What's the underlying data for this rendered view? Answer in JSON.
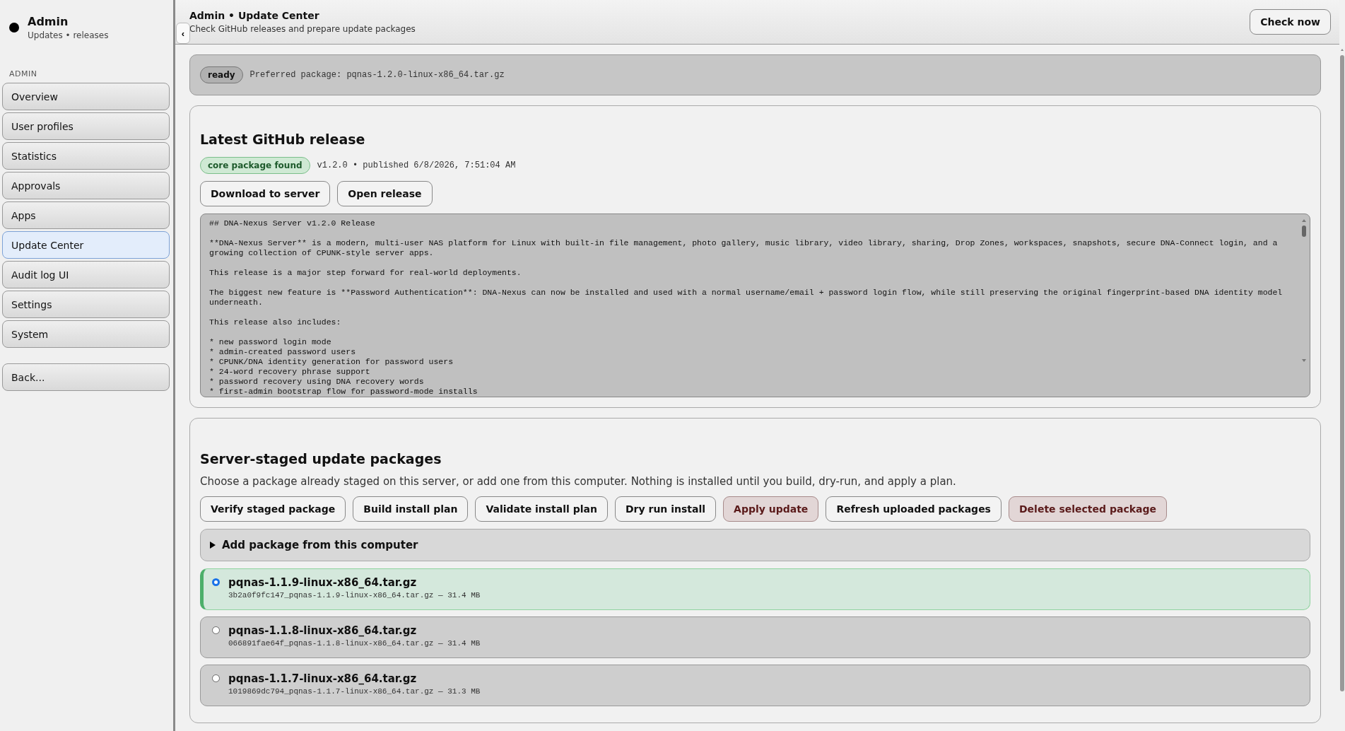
{
  "sidebar": {
    "title": "Admin",
    "subtitle": "Updates • releases",
    "section": "ADMIN",
    "items": [
      {
        "label": "Overview",
        "selected": false
      },
      {
        "label": "User profiles",
        "selected": false
      },
      {
        "label": "Statistics",
        "selected": false
      },
      {
        "label": "Approvals",
        "selected": false
      },
      {
        "label": "Apps",
        "selected": false
      },
      {
        "label": "Update Center",
        "selected": true
      },
      {
        "label": "Audit log UI",
        "selected": false
      },
      {
        "label": "Settings",
        "selected": false
      },
      {
        "label": "System",
        "selected": false
      }
    ],
    "back": "Back..."
  },
  "collapse_button": "‹",
  "header": {
    "title": "Admin • Update Center",
    "subtitle": "Check GitHub releases and prepare update packages",
    "button": "Check now"
  },
  "status": {
    "badge": "ready",
    "text": "Preferred package: pqnas-1.2.0-linux-x86_64.tar.gz"
  },
  "release": {
    "title": "Latest GitHub release",
    "badge": "core package found",
    "meta": "v1.2.0 • published 6/8/2026, 7:51:04 AM",
    "buttons": [
      "Download to server",
      "Open release"
    ],
    "notes": [
      "## DNA-Nexus Server v1.2.0 Release",
      "**DNA-Nexus Server** is a modern, multi-user NAS platform for Linux with built-in file management, photo gallery, music library, video library, sharing, Drop Zones, workspaces, snapshots, secure DNA-Connect login, and a growing collection of CPUNK-style server apps.",
      "This release is a major step forward for real-world deployments.",
      "The biggest new feature is **Password Authentication**: DNA-Nexus can now be installed and used with a normal username/email + password login flow, while still preserving the original fingerprint-based DNA identity model underneath.",
      "This release also includes:",
      "* new password login mode\n* admin-created password users\n* CPUNK/DNA identity generation for password users\n* 24-word recovery phrase support\n* password recovery using DNA recovery words\n* first-admin bootstrap flow for password-mode installs"
    ]
  },
  "packages": {
    "title": "Server-staged update packages",
    "description": "Choose a package already staged on this server, or add one from this computer. Nothing is installed until you build, dry-run, and apply a plan.",
    "buttons": [
      {
        "label": "Verify staged package",
        "kind": "normal"
      },
      {
        "label": "Build install plan",
        "kind": "normal"
      },
      {
        "label": "Validate install plan",
        "kind": "normal"
      },
      {
        "label": "Dry run install",
        "kind": "normal"
      },
      {
        "label": "Apply update",
        "kind": "danger"
      },
      {
        "label": "Refresh uploaded packages",
        "kind": "normal"
      },
      {
        "label": "Delete selected package",
        "kind": "danger"
      }
    ],
    "add_section": {
      "label": "Add package from this computer",
      "expanded": false
    },
    "items": [
      {
        "name": "pqnas-1.1.9-linux-x86_64.tar.gz",
        "detail": "3b2a0f9fc147_pqnas-1.1.9-linux-x86_64.tar.gz — 31.4 MB",
        "selected": true
      },
      {
        "name": "pqnas-1.1.8-linux-x86_64.tar.gz",
        "detail": "066891fae64f_pqnas-1.1.8-linux-x86_64.tar.gz — 31.4 MB",
        "selected": false
      },
      {
        "name": "pqnas-1.1.7-linux-x86_64.tar.gz",
        "detail": "1019869dc794_pqnas-1.1.7-linux-x86_64.tar.gz — 31.3 MB",
        "selected": false
      }
    ]
  }
}
